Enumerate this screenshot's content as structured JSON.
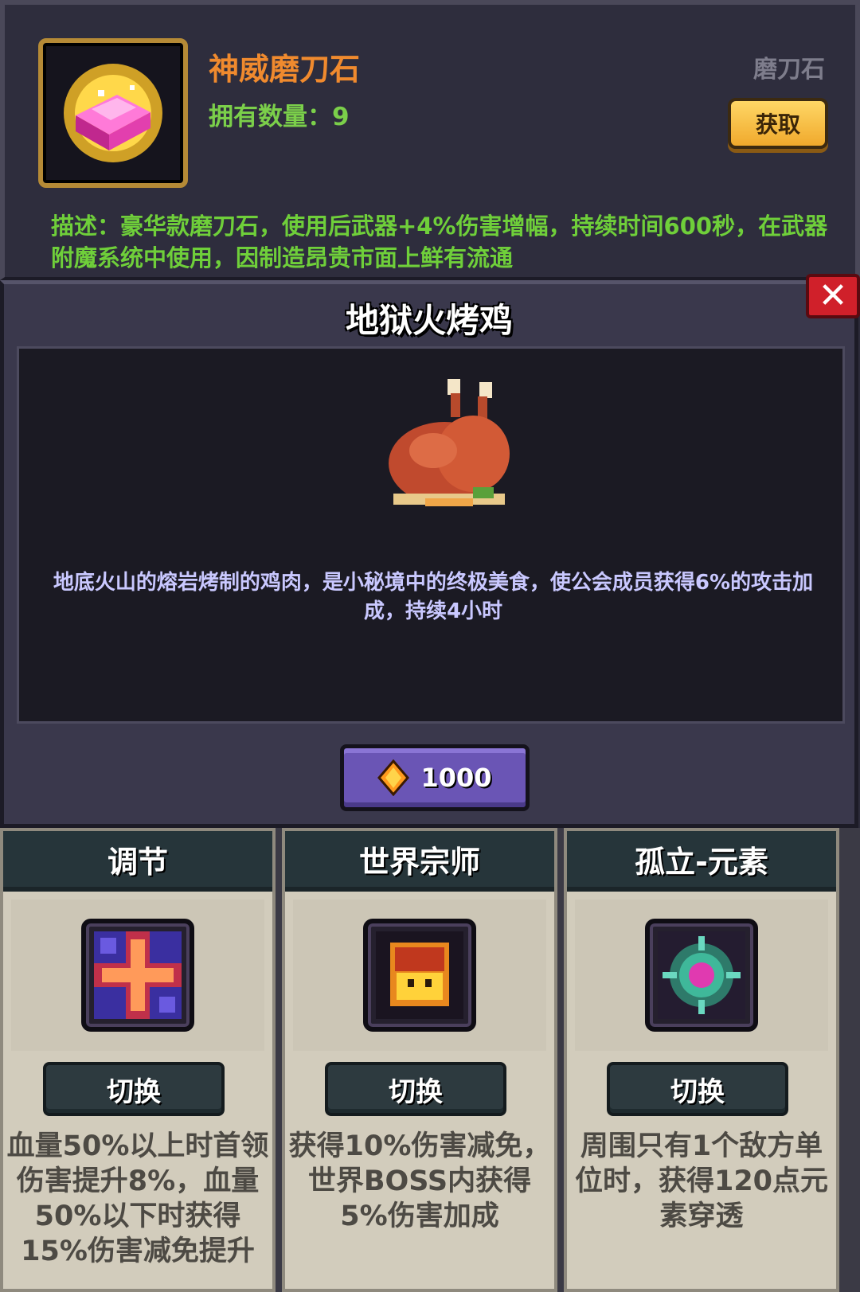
{
  "item": {
    "name": "神威磨刀石",
    "owned_label": "拥有数量：",
    "owned_count": "9",
    "category": "磨刀石",
    "get_button": "获取",
    "description": "描述：豪华款磨刀石，使用后武器+4%伤害增幅，持续时间600秒，在武器附魔系统中使用，因制造昂贵市面上鲜有流通",
    "icon": "pink-whetstone-icon"
  },
  "dialog": {
    "title": "地狱火烤鸡",
    "close_icon": "close-icon",
    "food_icon": "roast-chicken-icon",
    "description": "地底火山的熔岩烤制的鸡肉，是小秘境中的终极美食，使公会成员获得6%的攻击加成，持续4小时",
    "price_icon": "fire-gem-icon",
    "price": "1000"
  },
  "cards": [
    {
      "title": "调节",
      "icon": "cross-rune-icon",
      "button": "切换",
      "description": "血量50%以上时首领伤害提升8%，血量50%以下时获得15%伤害减免提升"
    },
    {
      "title": "世界宗师",
      "icon": "golden-helmet-icon",
      "button": "切换",
      "description": "获得10%伤害减免，世界BOSS内获得5%伤害加成"
    },
    {
      "title": "孤立-元素",
      "icon": "element-orb-icon",
      "button": "切换",
      "description": "周围只有1个敌方单位时，获得120点元素穿透"
    }
  ],
  "colors": {
    "item_name": "#f08a2e",
    "green_text": "#6fcf3a",
    "dialog_text": "#c9c8ff",
    "price_button": "#6a55b5",
    "card_bg": "#d2ccbc"
  }
}
